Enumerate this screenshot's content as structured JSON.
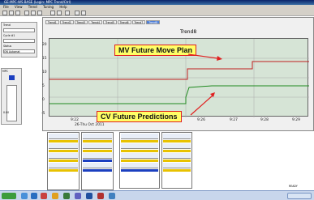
{
  "window": {
    "title": "GE-MPC-WS BASE (Login: MPC Trend/Ctrl)"
  },
  "menu": [
    "File",
    "View",
    "Trend",
    "Tuning",
    "Help"
  ],
  "tabs": [
    "Trend1",
    "Trend2",
    "Trend3",
    "Trend4",
    "Trend5",
    "Trend6",
    "Trend7",
    "Trend8"
  ],
  "trend": {
    "title": "Trend8",
    "date": "26-Thu Oct 2011",
    "times": [
      "9:22",
      "9:23",
      "9:24",
      "9:25",
      "9:26",
      "9:27",
      "9:28",
      "9:29"
    ],
    "ylabels": [
      "20",
      "15",
      "10",
      "5",
      "0",
      "-5"
    ]
  },
  "annotations": {
    "mv": "MV Future Move Plan",
    "cv": "CV Future Predictions"
  },
  "left_panel": {
    "trend_label": "Trend",
    "cycle_label": "Cycle #1",
    "mpc_label": "MPC",
    "status_label": "Status",
    "mode": "ON Automat",
    "zero": "0.00"
  },
  "status_bar": {
    "text": "READY"
  },
  "colors": {
    "mv_line": "#c02020",
    "cv_line": "#208a20",
    "plot_bg": "#d6e4d6",
    "label_bg": "#ffff66",
    "label_border": "#e02020"
  }
}
